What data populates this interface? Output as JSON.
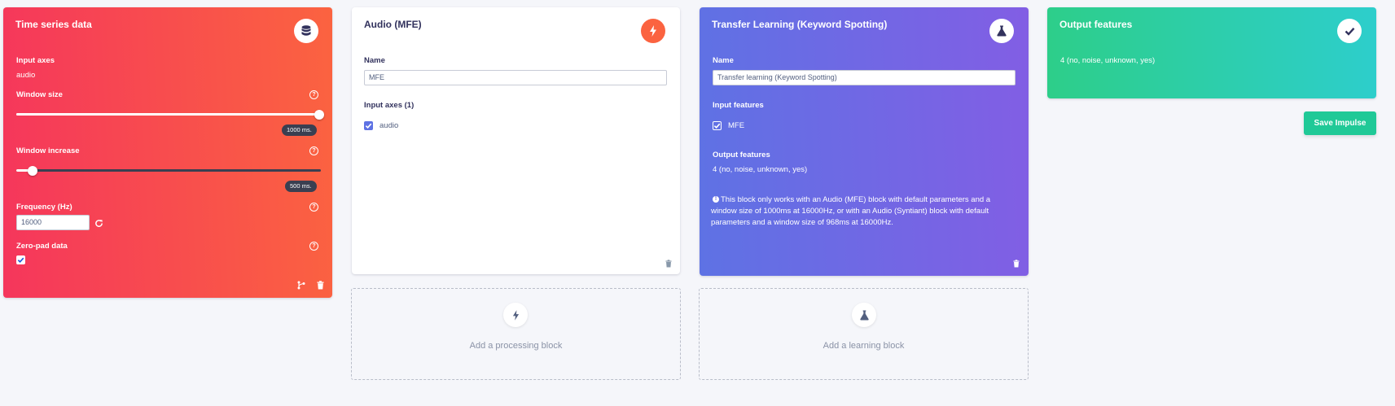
{
  "time_series": {
    "title": "Time series data",
    "icon": "database-icon",
    "input_axes_label": "Input axes",
    "input_axes_value": "audio",
    "window_size_label": "Window size",
    "window_size_value": "1000 ms.",
    "window_size_fraction": 1.0,
    "window_increase_label": "Window increase",
    "window_increase_value": "500 ms.",
    "window_increase_fraction": 0.05,
    "frequency_label": "Frequency (Hz)",
    "frequency_value": "16000",
    "zero_pad_label": "Zero-pad data",
    "zero_pad_checked": true,
    "help_glyph": "?"
  },
  "processing": {
    "title": "Audio (MFE)",
    "icon": "lightning-icon",
    "name_label": "Name",
    "name_value": "MFE",
    "input_axes_label": "Input axes (1)",
    "axis_item": "audio",
    "axis_checked": true
  },
  "learning": {
    "title": "Transfer Learning (Keyword Spotting)",
    "icon": "flask-icon",
    "name_label": "Name",
    "name_value": "Transfer learning (Keyword Spotting)",
    "input_features_label": "Input features",
    "input_feature_item": "MFE",
    "input_feature_checked": true,
    "output_features_label": "Output features",
    "output_features_value": "4 (no, noise, unknown, yes)",
    "note": "This block only works with an Audio (MFE) block with default parameters and a window size of 1000ms at 16000Hz, or with an Audio (Syntiant) block with default parameters and a window size of 968ms at 16000Hz."
  },
  "output": {
    "title": "Output features",
    "icon": "check-icon",
    "value": "4 (no, noise, unknown, yes)"
  },
  "add_processing": {
    "label": "Add a processing block",
    "icon": "lightning-icon"
  },
  "add_learning": {
    "label": "Add a learning block",
    "icon": "flask-icon"
  },
  "save_button": "Save Impulse",
  "colors": {
    "time_series_gradient": [
      "#f5365c",
      "#fb6340"
    ],
    "processing_icon": "#fb6340",
    "learning_gradient": [
      "#5e72e4",
      "#825ee4"
    ],
    "output_gradient": [
      "#2dce89",
      "#2dcecc"
    ],
    "save_button": "#20c997"
  }
}
